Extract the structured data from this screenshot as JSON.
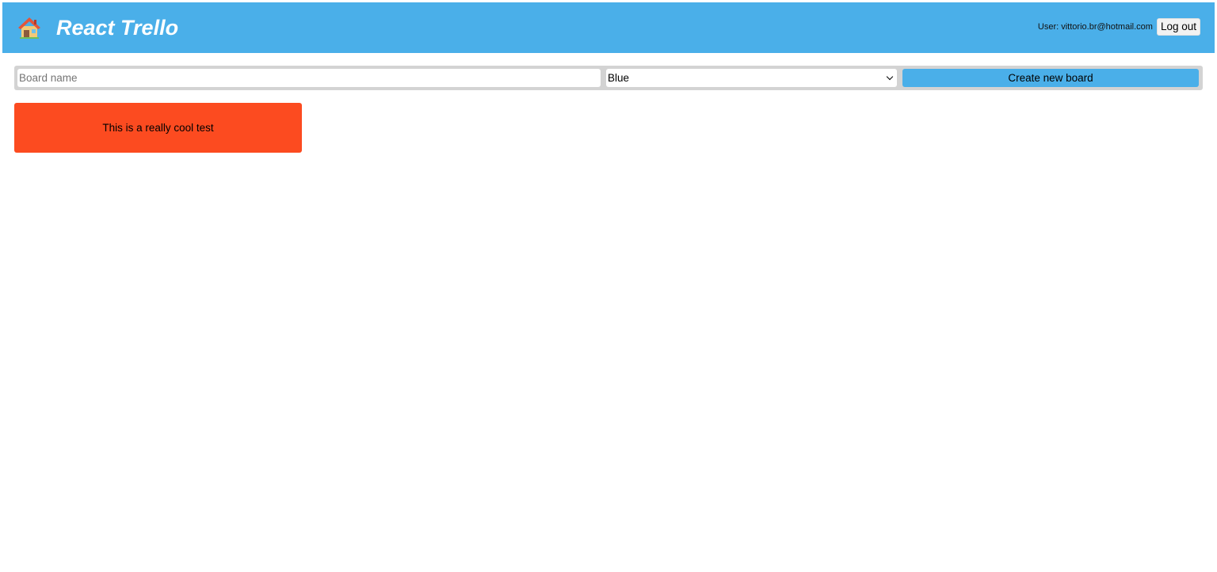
{
  "header": {
    "home_icon": "house-icon",
    "title": "React Trello",
    "user_text": "User: vittorio.br@hotmail.com",
    "logout_label": "Log out",
    "background_color": "#4aafe9"
  },
  "new_board_form": {
    "name_placeholder": "Board name",
    "name_value": "",
    "color_selected": "Blue",
    "create_label": "Create new board",
    "button_color": "#4aafe9"
  },
  "boards": [
    {
      "title": "This is a really cool test",
      "color": "#fc4b20"
    }
  ]
}
